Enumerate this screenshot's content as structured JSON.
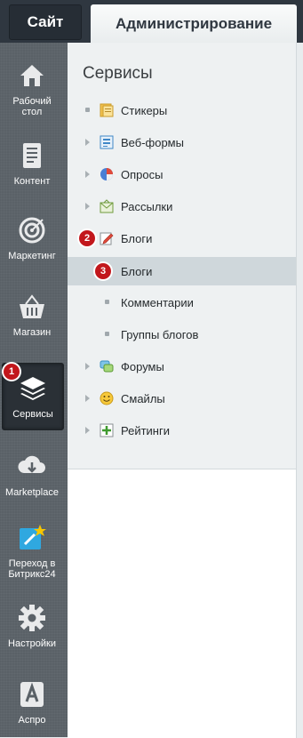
{
  "top_tabs": {
    "site": "Сайт",
    "admin": "Администрирование"
  },
  "sidebar": {
    "items": [
      {
        "label": "Рабочий стол",
        "icon": "home-icon"
      },
      {
        "label": "Контент",
        "icon": "document-icon"
      },
      {
        "label": "Маркетинг",
        "icon": "target-icon"
      },
      {
        "label": "Магазин",
        "icon": "basket-icon"
      },
      {
        "label": "Сервисы",
        "icon": "layers-icon",
        "active": true,
        "badge": "1"
      },
      {
        "label": "Marketplace",
        "icon": "cloud-download-icon"
      },
      {
        "label": "Переход в Битрикс24",
        "icon": "bitrix24-icon"
      },
      {
        "label": "Настройки",
        "icon": "gear-icon"
      },
      {
        "label": "Аспро",
        "icon": "aspro-icon"
      }
    ]
  },
  "panel": {
    "title": "Сервисы",
    "tree": [
      {
        "label": "Стикеры",
        "icon": "sticker-icon"
      },
      {
        "label": "Веб-формы",
        "icon": "form-icon"
      },
      {
        "label": "Опросы",
        "icon": "poll-icon"
      },
      {
        "label": "Рассылки",
        "icon": "mail-icon"
      },
      {
        "label": "Блоги",
        "icon": "blog-icon",
        "badge": "2"
      },
      {
        "label": "Блоги",
        "selected": true,
        "badge": "3"
      },
      {
        "label": "Комментарии"
      },
      {
        "label": "Группы блогов"
      },
      {
        "label": "Форумы",
        "icon": "forum-icon"
      },
      {
        "label": "Смайлы",
        "icon": "smile-icon"
      },
      {
        "label": "Рейтинги",
        "icon": "rating-icon"
      }
    ]
  },
  "colors": {
    "badge": "#c2171c",
    "sidebar": "#5a6167",
    "topbar": "#2f3740",
    "selected_row": "#cfd7db"
  }
}
